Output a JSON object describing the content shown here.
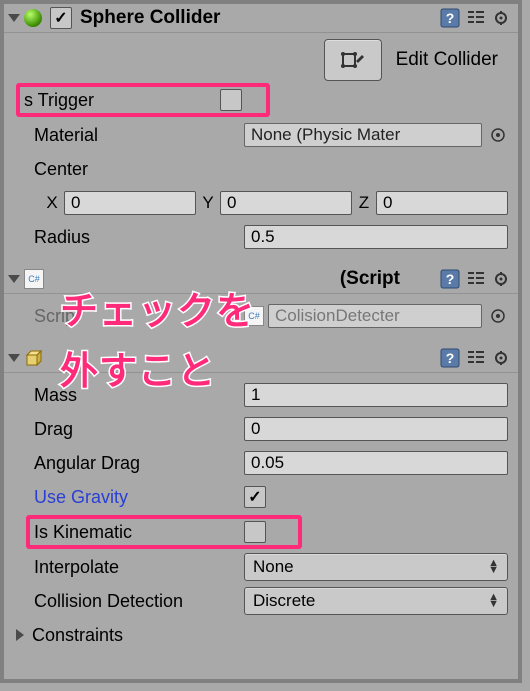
{
  "sphere": {
    "title": "Sphere Collider",
    "editBtn": "Edit Collider",
    "isTriggerLabel": "s Trigger",
    "isTriggerChecked": false,
    "materialLabel": "Material",
    "materialValue": "None (Physic Mater",
    "centerLabel": "Center",
    "x": "0",
    "y": "0",
    "z": "0",
    "radiusLabel": "Radius",
    "radius": "0.5"
  },
  "scriptComp": {
    "titleSuffix": "(Script",
    "scriptLabel": "Script",
    "scriptValue": "ColisionDetecter"
  },
  "rigidbody": {
    "massLabel": "Mass",
    "mass": "1",
    "dragLabel": "Drag",
    "drag": "0",
    "angularDragLabel": "Angular Drag",
    "angularDrag": "0.05",
    "useGravityLabel": "Use Gravity",
    "useGravity": true,
    "isKinematicLabel": "Is Kinematic",
    "isKinematic": false,
    "interpolateLabel": "Interpolate",
    "interpolate": "None",
    "collisionLabel": "Collision Detection",
    "collision": "Discrete",
    "constraintsLabel": "Constraints"
  },
  "axis": {
    "x": "X",
    "y": "Y",
    "z": "Z"
  },
  "annotation": {
    "line1": "チェックを",
    "line2": "外すこと"
  }
}
